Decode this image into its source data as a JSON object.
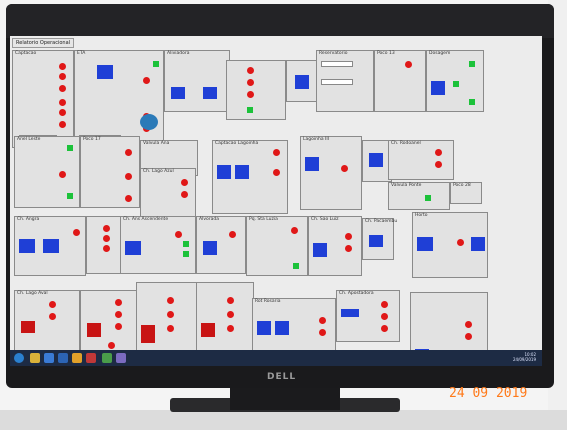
{
  "screen": {
    "tab_label": "Relatorio Operacional",
    "section_titles": [
      "Captacao",
      "ETA",
      "Aliviadora",
      "Reservatorio",
      "Poco 13",
      "Dosagem",
      "Anel Leste",
      "Poco 17",
      "Valvula Ana",
      "Poco 12",
      "Ch. Lago Azul",
      "Captacao Lagoinha",
      "Lagoinha III",
      "Ch. Rodoanel",
      "Valvula Ponte",
      "Poco 28",
      "Ch. Angra",
      "Ch. Ans Ascendente",
      "Alvorada",
      "Pq. Sta Luzia",
      "Ch. Sao Luiz",
      "Ch. Pacaembu",
      "Horto",
      "Ch. Lago Aval",
      "Rot Rosaria",
      "Ch. Apostadora"
    ],
    "taskbar": {
      "clock": "10:02",
      "date": "24/09/2019"
    }
  },
  "monitor": {
    "brand": "DELL"
  },
  "photo_stamp": "24 09 2019",
  "colors": {
    "pump_on": "#1cc23a",
    "pump_off": "#e01818",
    "tank": "#1f3fd6",
    "panel": "#e2e2e2",
    "stamp": "#ff7a1a"
  }
}
